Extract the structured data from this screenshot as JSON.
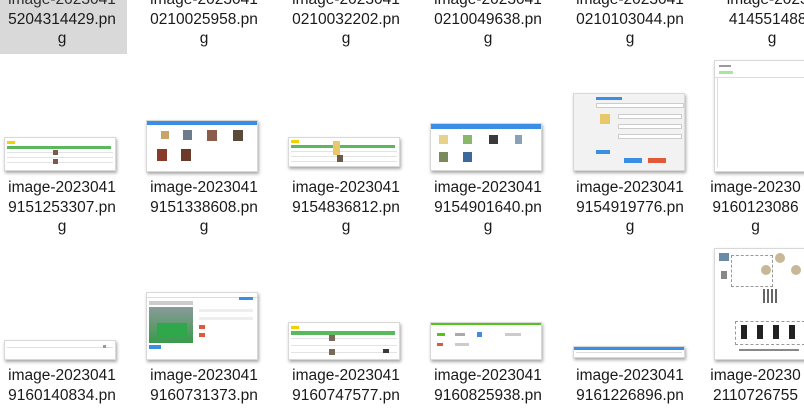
{
  "files": {
    "row0": [
      {
        "line1": "5204314429.pn",
        "line2": "g"
      },
      {
        "line1": "0210025958.pn",
        "line2": "g"
      },
      {
        "line1": "0210032202.pn",
        "line2": "g"
      },
      {
        "line1": "0210049638.pn",
        "line2": "g"
      },
      {
        "line1": "0210103044.pn",
        "line2": "g"
      },
      {
        "line1": "4145514884",
        "line2": "g"
      }
    ],
    "row1": [
      {
        "line1": "image-2023041",
        "line2": "9151253307.pn",
        "line3": "g"
      },
      {
        "line1": "image-2023041",
        "line2": "9151338608.pn",
        "line3": "g"
      },
      {
        "line1": "image-2023041",
        "line2": "9154836812.pn",
        "line3": "g"
      },
      {
        "line1": "image-2023041",
        "line2": "9154901640.pn",
        "line3": "g"
      },
      {
        "line1": "image-2023041",
        "line2": "9154919776.pn",
        "line3": "g"
      },
      {
        "line1": "image-20230",
        "line2": "9160123086",
        "line3": "g"
      }
    ],
    "row2": [
      {
        "line1": "image-2023041",
        "line2": "9160140834.pn"
      },
      {
        "line1": "image-2023041",
        "line2": "9160731373.pn"
      },
      {
        "line1": "image-2023041",
        "line2": "9160747577.pn"
      },
      {
        "line1": "image-2023041",
        "line2": "9160825938.pn"
      },
      {
        "line1": "image-2023041",
        "line2": "9161226896.pn"
      },
      {
        "line1": "image-20230",
        "line2": "2110726755"
      }
    ]
  },
  "colors": {
    "selected_bg": "#d9d9d9",
    "accent_blue": "#3a8ee6",
    "accent_green": "#52c41a"
  }
}
